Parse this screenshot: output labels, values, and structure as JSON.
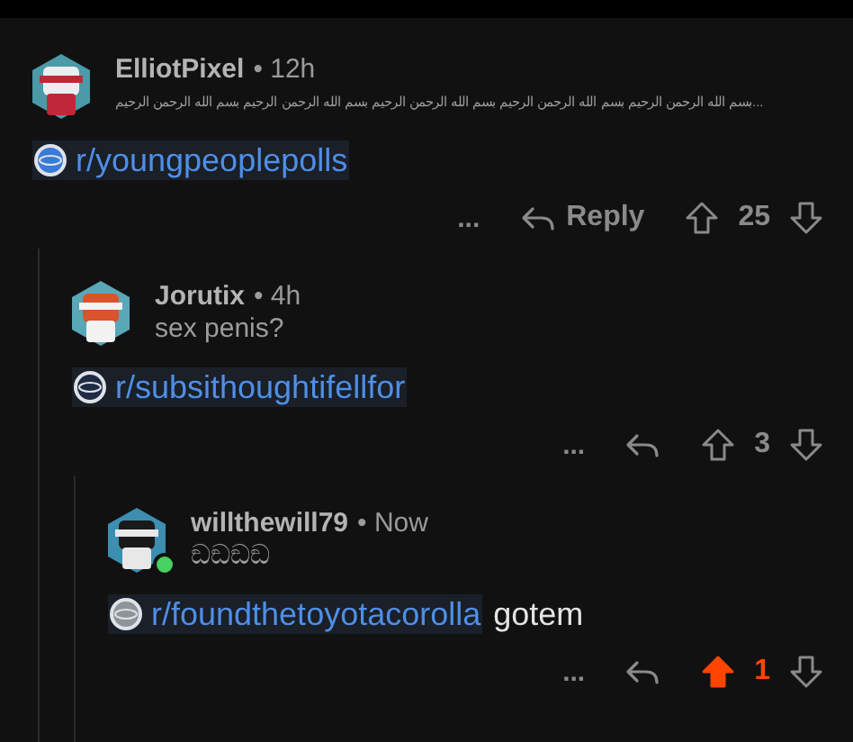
{
  "comments": [
    {
      "author": "ElliotPixel",
      "time": "• 12h",
      "flair": "بسم الله الرحمن الرحيم بسم الله الرحمن الرحيم بسم الله الرحمن الرحيم بسم الله الرحمن الرحيم بسم الله الرحمن الرحيم...",
      "online": false,
      "link": "r/youngpeoplepolls",
      "more": "...",
      "reply": "Reply",
      "score": "25",
      "upvoted": false,
      "replies": [
        {
          "author": "Jorutix",
          "time": "• 4h",
          "flair": "sex penis?",
          "online": false,
          "link": "r/subsithoughtifellfor",
          "more": "...",
          "score": "3",
          "upvoted": false,
          "replies": [
            {
              "author": "willthewill79",
              "time": "• Now",
              "flair": "ඞඞඞඞ",
              "online": true,
              "link": "r/foundthetoyotacorolla",
              "after": "gotem",
              "more": "...",
              "score": "1",
              "upvoted": true
            }
          ]
        }
      ]
    }
  ]
}
